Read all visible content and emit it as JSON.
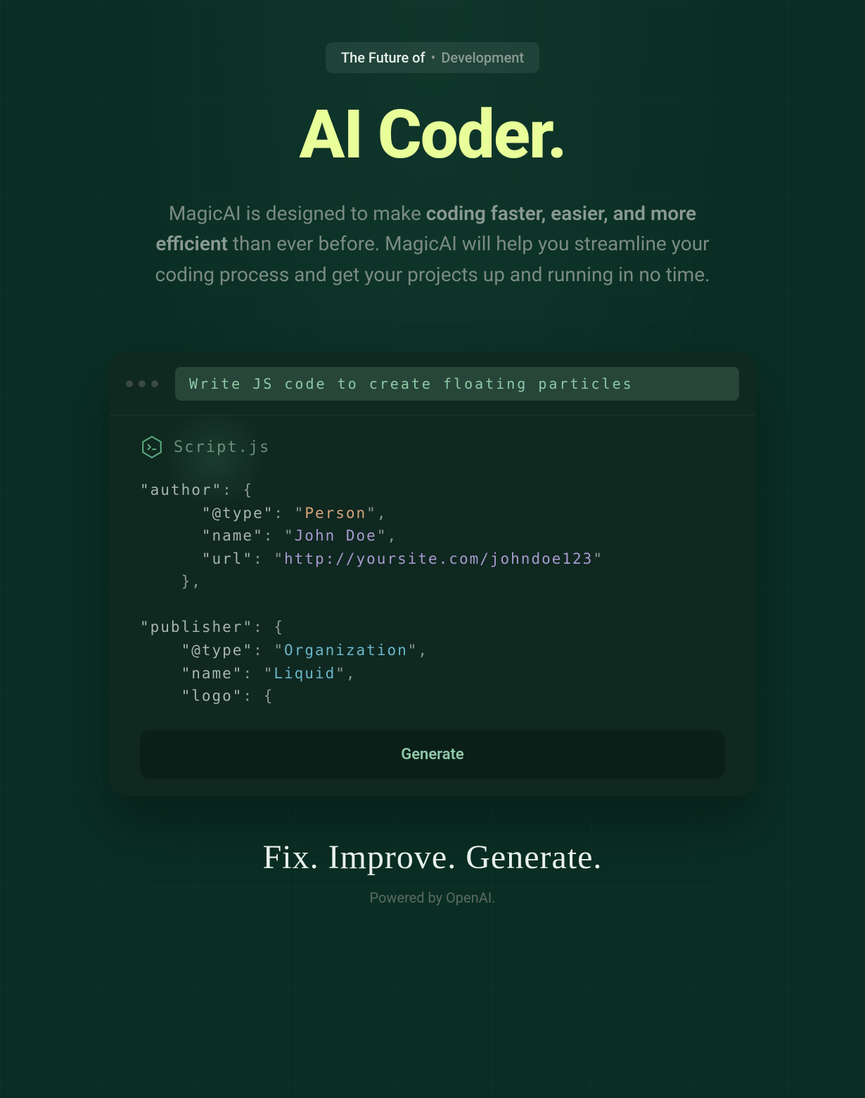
{
  "badge": {
    "prefix": "The Future of",
    "dot": "•",
    "suffix": "Development"
  },
  "hero": {
    "title": "AI Coder.",
    "desc_pre": "MagicAI is designed to make ",
    "desc_bold": "coding faster, easier, and more efficient",
    "desc_post": " than ever before. MagicAI will help you streamline your coding process and get your projects up and running in no time."
  },
  "window": {
    "prompt": "Write JS code to create floating particles",
    "filename": "Script.js",
    "generate_label": "Generate"
  },
  "code": {
    "line1_key": "\"author\"",
    "line1_rest": ": {",
    "line2_key": "\"@type\"",
    "line2_q1": ": \"",
    "line2_val": "Person",
    "line2_q2": "\",",
    "line3_key": "\"name\"",
    "line3_q1": ": \"",
    "line3_val": "John Doe",
    "line3_q2": "\",",
    "line4_key": "\"url\"",
    "line4_q1": ": \"",
    "line4_val": "http://yoursite.com/johndoe123",
    "line4_q2": "\"",
    "line5": "},",
    "line6_key": "\"publisher\"",
    "line6_rest": ": {",
    "line7_key": "\"@type\"",
    "line7_q1": ": \"",
    "line7_val": "Organization",
    "line7_q2": "\",",
    "line8_key": "\"name\"",
    "line8_q1": ": \"",
    "line8_val": "Liquid",
    "line8_q2": "\",",
    "line9_key": "\"logo\"",
    "line9_rest": ": {"
  },
  "footer": {
    "tagline": "Fix. Improve. Generate.",
    "powered": "Powered by OpenAI."
  },
  "colors": {
    "accent": "#e8ff9a",
    "bg": "#0a2e24",
    "window_bg": "#0f2820"
  }
}
